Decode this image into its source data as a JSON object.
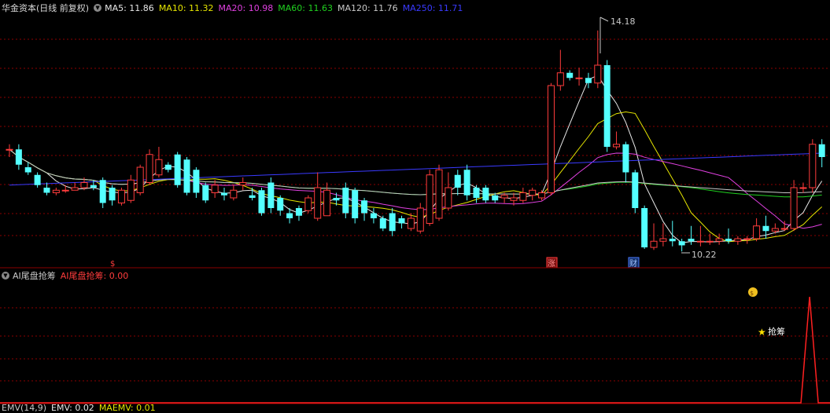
{
  "main_chart": {
    "title": "华金资本(日线 前复权)",
    "ma_legend": [
      {
        "label": "MA5: 11.86",
        "color": "#e8e8e8"
      },
      {
        "label": "MA10: 11.32",
        "color": "#e6e600"
      },
      {
        "label": "MA20: 10.98",
        "color": "#e040e0"
      },
      {
        "label": "MA60: 11.63",
        "color": "#20d020"
      },
      {
        "label": "MA120: 11.76",
        "color": "#c8c8c8"
      },
      {
        "label": "MA250: 11.71",
        "color": "#3a3aff"
      }
    ],
    "high_marker": "14.18",
    "low_marker": "10.22",
    "event_markers": [
      "$",
      "涨",
      "财"
    ]
  },
  "indicator": {
    "title": "AI尾盘抢筹",
    "value_label": "AI尾盘抢筹: 0.00",
    "signal_label": "抢筹"
  },
  "emv": {
    "title": "EMV(14,9)",
    "emv_label": "EMV: 0.02",
    "maemv_label": "MAEMV: 0.01"
  },
  "colors": {
    "up": "#ff3c3c",
    "down": "#54ffff",
    "grid": "#8b0000",
    "signal": "#ff2020"
  },
  "chart_data": {
    "type": "candlestick",
    "x_index": [
      0,
      1,
      2,
      3,
      4,
      5,
      6,
      7,
      8,
      9,
      10,
      11,
      12,
      13,
      14,
      15,
      16,
      17,
      18,
      19,
      20,
      21,
      22,
      23,
      24,
      25,
      26,
      27,
      28,
      29,
      30,
      31,
      32,
      33,
      34,
      35,
      36,
      37,
      38,
      39,
      40,
      41,
      42,
      43,
      44,
      45,
      46,
      47,
      48,
      49,
      50,
      51,
      52,
      53,
      54,
      55,
      56,
      57,
      58,
      59,
      60,
      61,
      62,
      63,
      64,
      65,
      66,
      67,
      68,
      69,
      70,
      71,
      72,
      73,
      74,
      75,
      76,
      77,
      78,
      79,
      80,
      81,
      82,
      83,
      84,
      85,
      86,
      87
    ],
    "open": [
      11.85,
      11.85,
      11.5,
      11.35,
      11.1,
      11.0,
      11.05,
      11.05,
      11.1,
      11.15,
      11.25,
      11.1,
      10.8,
      10.85,
      11.0,
      11.2,
      11.35,
      11.55,
      11.75,
      11.65,
      11.45,
      11.15,
      11.0,
      11.0,
      10.9,
      11.15,
      10.95,
      11.05,
      11.2,
      10.9,
      10.6,
      10.7,
      10.65,
      10.5,
      10.55,
      10.9,
      11.1,
      11.05,
      10.85,
      10.6,
      10.5,
      10.6,
      10.5,
      10.3,
      10.25,
      10.4,
      10.5,
      10.7,
      11.35,
      11.45,
      11.1,
      11.1,
      10.95,
      10.9,
      10.85,
      10.85,
      10.95,
      10.9,
      11.0,
      13.1,
      13.35,
      13.25,
      13.25,
      13.15,
      13.5,
      11.9,
      11.95,
      11.4,
      10.7,
      9.93,
      10.05,
      10.1,
      10.05,
      10.1,
      10.05,
      10.05,
      10.05,
      10.1,
      10.05,
      10.1,
      10.1,
      10.35,
      10.25,
      10.3,
      10.3,
      11.1,
      11.1,
      11.95
    ],
    "close": [
      11.85,
      11.55,
      11.4,
      11.15,
      11.0,
      11.05,
      11.05,
      11.1,
      11.2,
      11.1,
      10.8,
      10.85,
      11.05,
      11.25,
      11.5,
      11.75,
      11.65,
      11.45,
      11.15,
      11.0,
      11.0,
      10.85,
      11.15,
      10.95,
      11.05,
      11.2,
      10.9,
      10.6,
      10.7,
      10.65,
      10.5,
      10.55,
      10.9,
      11.1,
      11.05,
      10.85,
      10.6,
      10.5,
      10.6,
      10.5,
      10.3,
      10.25,
      10.4,
      10.5,
      10.7,
      11.35,
      11.45,
      11.1,
      11.1,
      10.95,
      10.9,
      10.85,
      10.85,
      10.95,
      10.9,
      11.0,
      11.05,
      11.0,
      13.1,
      13.35,
      13.25,
      13.25,
      13.15,
      13.5,
      11.9,
      11.95,
      11.4,
      10.7,
      9.93,
      10.05,
      10.1,
      10.05,
      9.97,
      10.05,
      10.05,
      10.05,
      10.1,
      10.05,
      10.1,
      10.1,
      10.35,
      10.25,
      10.3,
      10.3,
      11.1,
      11.1,
      11.95,
      11.7
    ],
    "high": [
      11.95,
      11.95,
      11.6,
      11.4,
      11.2,
      11.1,
      11.15,
      11.2,
      11.3,
      11.25,
      11.3,
      11.15,
      11.1,
      11.35,
      11.55,
      11.85,
      11.9,
      11.6,
      11.8,
      11.7,
      11.5,
      11.2,
      11.25,
      11.1,
      11.15,
      11.3,
      11.1,
      11.1,
      11.3,
      10.95,
      10.7,
      10.75,
      10.95,
      11.4,
      11.2,
      11.0,
      11.2,
      11.1,
      10.9,
      10.7,
      10.55,
      10.7,
      10.55,
      10.6,
      10.8,
      11.45,
      11.55,
      11.4,
      11.45,
      11.55,
      11.15,
      11.15,
      11.0,
      11.0,
      11.0,
      11.1,
      11.1,
      11.05,
      13.15,
      13.8,
      13.4,
      13.45,
      13.35,
      14.18,
      13.6,
      12.2,
      12.0,
      11.45,
      10.75,
      10.4,
      10.4,
      10.45,
      10.1,
      10.35,
      10.35,
      10.2,
      10.2,
      10.3,
      10.15,
      10.15,
      10.5,
      10.55,
      10.4,
      10.45,
      11.25,
      11.2,
      12.05,
      12.05
    ],
    "low": [
      11.7,
      11.45,
      11.35,
      11.1,
      10.95,
      10.95,
      11.0,
      11.05,
      11.05,
      11.05,
      10.7,
      10.75,
      10.75,
      10.8,
      10.95,
      11.15,
      11.3,
      11.4,
      11.1,
      10.95,
      10.9,
      10.8,
      10.9,
      10.85,
      10.85,
      11.05,
      10.85,
      10.55,
      10.6,
      10.55,
      10.4,
      10.45,
      10.6,
      10.45,
      10.95,
      10.75,
      10.5,
      10.4,
      10.45,
      10.4,
      10.25,
      10.15,
      10.3,
      10.25,
      10.2,
      10.35,
      10.45,
      10.65,
      10.95,
      10.85,
      10.8,
      10.8,
      10.8,
      10.8,
      10.75,
      10.8,
      10.85,
      10.85,
      10.95,
      13.0,
      13.2,
      13.1,
      13.05,
      13.05,
      11.8,
      11.85,
      11.2,
      10.6,
      9.9,
      9.88,
      9.95,
      9.95,
      9.85,
      9.98,
      9.95,
      9.98,
      9.98,
      10.0,
      9.98,
      10.0,
      10.05,
      10.1,
      10.2,
      10.25,
      10.25,
      11.0,
      11.0,
      11.5
    ],
    "price_range": [
      9.7,
      14.5
    ],
    "indicator_spike_index": 84,
    "indicator_range": [
      0,
      1
    ]
  }
}
